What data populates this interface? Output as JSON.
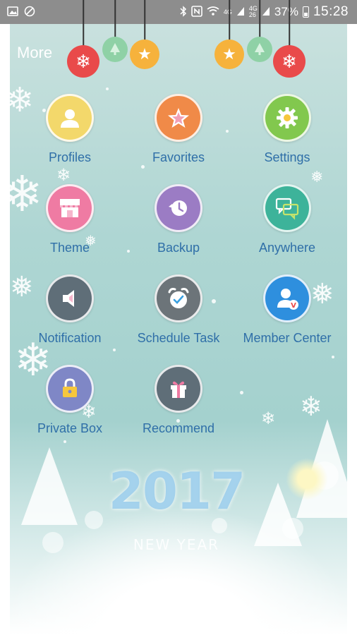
{
  "status_bar": {
    "signal_small_top": "4G",
    "signal_small_mid": "4G",
    "signal_small_bot": "26",
    "battery": "37%",
    "time": "15:28"
  },
  "header": {
    "title": "More"
  },
  "grid": [
    {
      "label": "Profiles",
      "icon": "profile-icon",
      "color": "#f3d86b"
    },
    {
      "label": "Favorites",
      "icon": "star-icon",
      "color": "#f08a48"
    },
    {
      "label": "Settings",
      "icon": "gear-icon",
      "color": "#82c84e"
    },
    {
      "label": "Theme",
      "icon": "store-icon",
      "color": "#ef7ba3"
    },
    {
      "label": "Backup",
      "icon": "backup-icon",
      "color": "#9b7cc4"
    },
    {
      "label": "Anywhere",
      "icon": "chat-icon",
      "color": "#3db39a"
    },
    {
      "label": "Notification",
      "icon": "speaker-icon",
      "color": "#5f6e78"
    },
    {
      "label": "Schedule Task",
      "icon": "alarm-clock-icon",
      "color": "#6c7479"
    },
    {
      "label": "Member Center",
      "icon": "member-icon",
      "color": "#2e8fde"
    },
    {
      "label": "Private Box",
      "icon": "lock-icon",
      "color": "#7f87c6"
    },
    {
      "label": "Recommend",
      "icon": "gift-icon",
      "color": "#5f6e78"
    }
  ],
  "background": {
    "year": "2017",
    "subtitle": "NEW YEAR"
  }
}
